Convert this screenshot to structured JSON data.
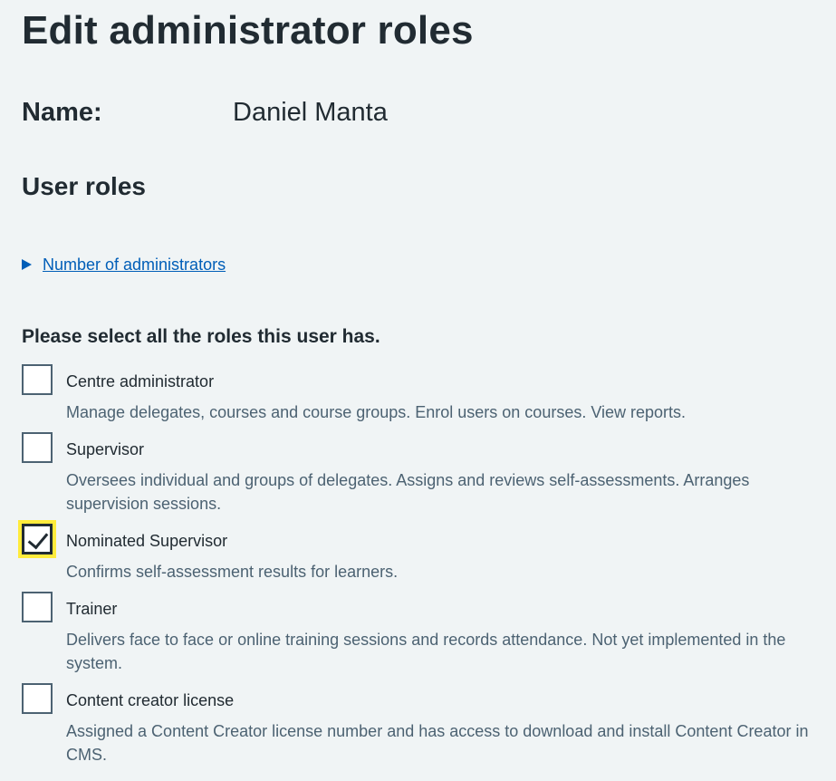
{
  "page": {
    "title": "Edit administrator roles"
  },
  "user": {
    "name_label": "Name:",
    "name_value": "Daniel Manta"
  },
  "roles_section": {
    "heading": "User roles",
    "details_summary": "Number of administrators",
    "legend": "Please select all the roles this user has."
  },
  "roles": [
    {
      "label": "Centre administrator",
      "hint": "Manage delegates, courses and course groups. Enrol users on courses. View reports.",
      "checked": false
    },
    {
      "label": "Supervisor",
      "hint": "Oversees individual and groups of delegates. Assigns and reviews self-assessments. Arranges supervision sessions.",
      "checked": false
    },
    {
      "label": "Nominated Supervisor",
      "hint": "Confirms self-assessment results for learners.",
      "checked": true
    },
    {
      "label": "Trainer",
      "hint": "Delivers face to face or online training sessions and records attendance. Not yet implemented in the system.",
      "checked": false
    },
    {
      "label": "Content creator license",
      "hint": "Assigned a Content Creator license number and has access to download and install Content Creator in CMS.",
      "checked": false
    }
  ],
  "colors": {
    "background": "#f0f4f5",
    "text": "#212b32",
    "link": "#005eb8",
    "hint": "#4c6272",
    "focus": "#ffeb3b"
  },
  "icons": {
    "details_toggle": "triangle-right-icon",
    "checkmark": "checkmark-icon"
  }
}
